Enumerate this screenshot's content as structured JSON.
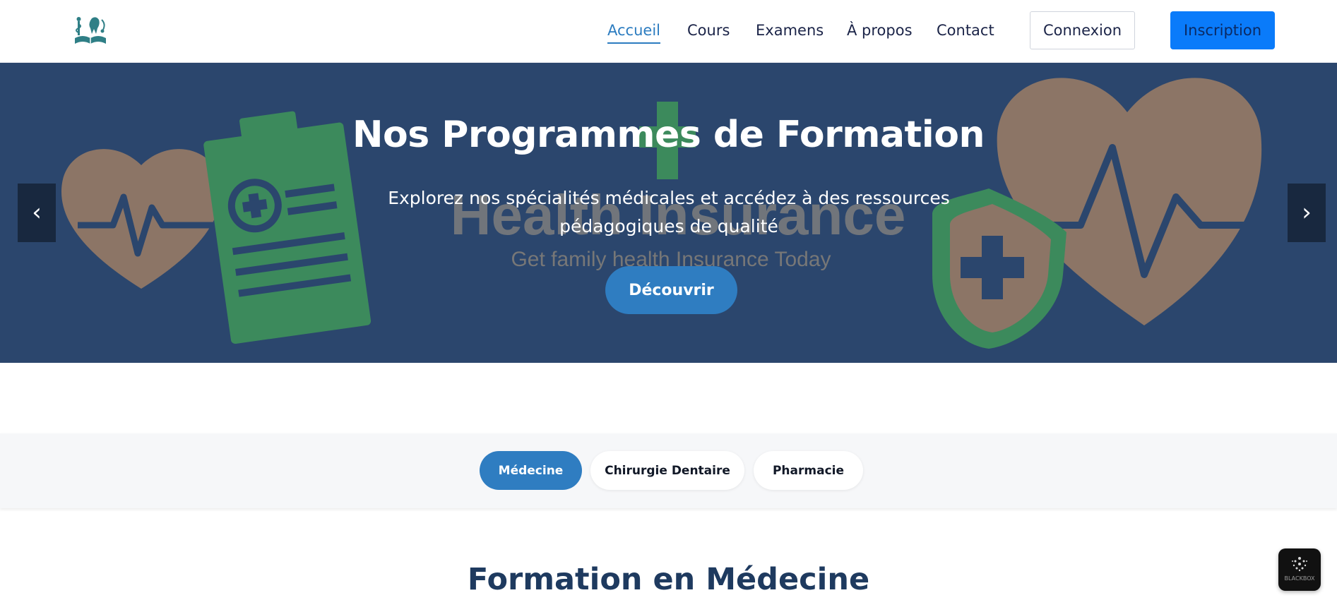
{
  "header": {
    "logo_icon": "medical-education-logo-icon",
    "nav": [
      {
        "label": "Accueil",
        "active": true
      },
      {
        "label": "Cours",
        "active": false
      },
      {
        "label": "Examens",
        "active": false
      },
      {
        "label": "À propos",
        "active": false
      },
      {
        "label": "Contact",
        "active": false
      }
    ],
    "login_label": "Connexion",
    "signup_label": "Inscription"
  },
  "hero": {
    "title": "Nos Programmes de Formation",
    "subtitle": "Explorez nos spécialités médicales et accédez à des ressources pédagogiques de qualité",
    "cta_label": "Découvrir",
    "background_text": "Health Insurance",
    "background_subtext": "Get family health Insurance Today",
    "prev_icon": "‹",
    "next_icon": "›"
  },
  "tabs": [
    {
      "label": "Médecine",
      "active": true
    },
    {
      "label": "Chirurgie Dentaire",
      "active": false
    },
    {
      "label": "Pharmacie",
      "active": false
    }
  ],
  "section": {
    "title": "Formation en Médecine"
  },
  "widget": {
    "label": "BLACKBOX"
  },
  "colors": {
    "accent": "#2f7dc1",
    "signup_bg": "#0a7bfa",
    "hero_bg": "#2b466d",
    "heart": "#8c7566",
    "clipboard": "#3c8a5c"
  }
}
